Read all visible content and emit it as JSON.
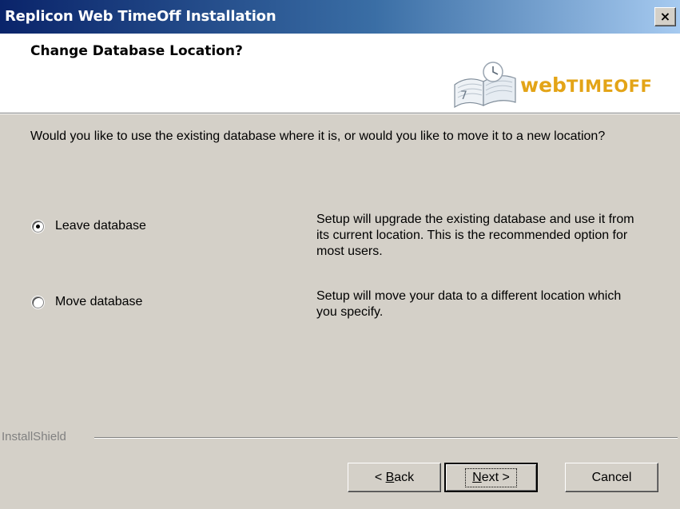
{
  "window": {
    "title": "Replicon Web TimeOff Installation",
    "close_glyph": "×"
  },
  "header": {
    "title": "Change Database Location?",
    "logo": {
      "word_web": "web",
      "word_timeoff": "TIMEOFF",
      "icon": "open-book-clock-icon",
      "color": "#e3a417"
    }
  },
  "body": {
    "question": "Would you like to use the existing database where it is, or would you like to move it to a new location?",
    "options": [
      {
        "label": "Leave database",
        "checked": true,
        "description": "Setup will upgrade the existing database and use it from its current location.  This is the recommended option for most users."
      },
      {
        "label": "Move database",
        "checked": false,
        "description": "Setup will move your data to a different location which you specify."
      }
    ]
  },
  "footer": {
    "brand": "InstallShield",
    "buttons": {
      "back": {
        "prefix": "< ",
        "mnemonic": "B",
        "rest": "ack"
      },
      "next": {
        "mnemonic": "N",
        "rest": "ext >"
      },
      "cancel": "Cancel"
    }
  },
  "colors": {
    "titlebar_start": "#0a246a",
    "titlebar_end": "#a6caf0",
    "dialog_bg": "#d4d0c8"
  }
}
